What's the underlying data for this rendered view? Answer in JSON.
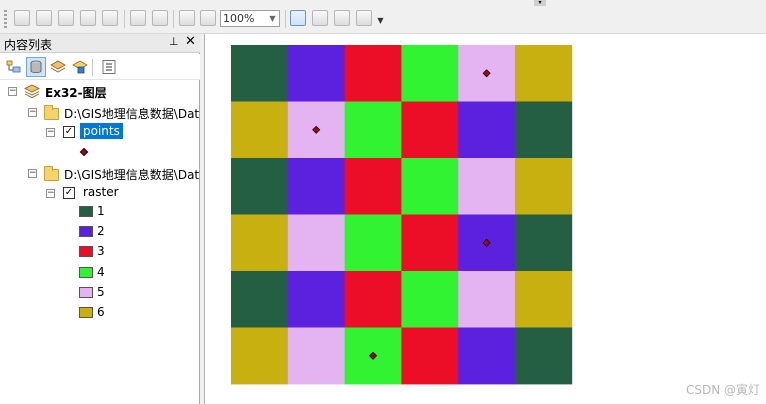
{
  "toolbar": {
    "zoom_value": "100%",
    "buttons": [
      "zoom-in-fixed-icon",
      "zoom-out-fixed-icon",
      "pan-icon",
      "full-extent-icon",
      "fixed-zoom-icon",
      "fixed-zoom-in-icon",
      "fixed-zoom-out-icon",
      "back-extent-icon",
      "forward-extent-icon",
      "toggle-draft-mode-icon",
      "focus-data-frame-icon",
      "change-layout-icon",
      "data-driven-pages-icon"
    ]
  },
  "toc": {
    "title": "内容列表",
    "pin_glyph": "ᵱ",
    "close_glyph": "✕",
    "root_label": "Ex32-图层",
    "folder1_label": "D:\\GIS地理信息数据\\Dat",
    "layer1_label": "points",
    "folder2_label": "D:\\GIS地理信息数据\\Dat",
    "layer2_label": "raster",
    "legend": [
      {
        "value": "1",
        "color": "#245e43"
      },
      {
        "value": "2",
        "color": "#5b21df"
      },
      {
        "value": "3",
        "color": "#ec0e26"
      },
      {
        "value": "4",
        "color": "#32f332"
      },
      {
        "value": "5",
        "color": "#e4b4f2"
      },
      {
        "value": "6",
        "color": "#c8b011"
      }
    ]
  },
  "raster": {
    "rows": [
      [
        1,
        2,
        3,
        4,
        5,
        6
      ],
      [
        6,
        5,
        4,
        3,
        2,
        1
      ],
      [
        1,
        2,
        3,
        4,
        5,
        6
      ],
      [
        6,
        5,
        4,
        3,
        2,
        1
      ],
      [
        1,
        2,
        3,
        4,
        5,
        6
      ],
      [
        6,
        5,
        4,
        3,
        2,
        1
      ]
    ],
    "point_cells": [
      [
        0,
        4
      ],
      [
        1,
        1
      ],
      [
        3,
        4
      ],
      [
        5,
        2
      ]
    ],
    "point_color": "#8b0f1e"
  },
  "watermark": "CSDN @寅灯"
}
